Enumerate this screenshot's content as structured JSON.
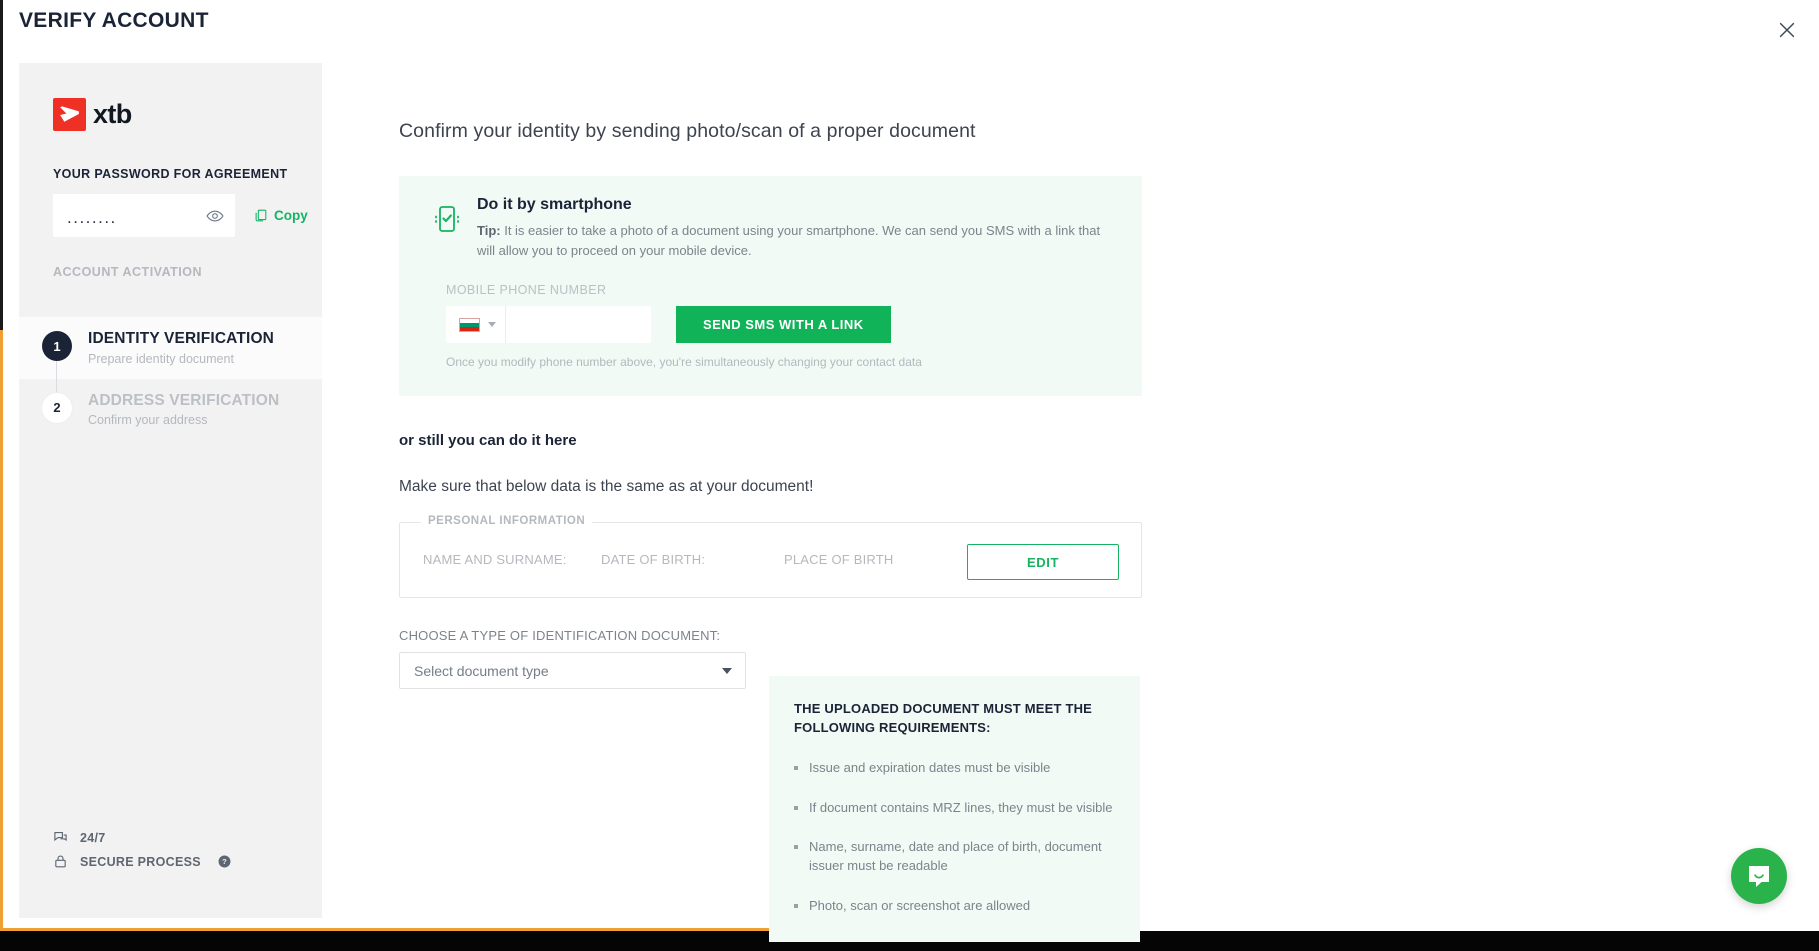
{
  "header": {
    "title": "VERIFY ACCOUNT",
    "close_icon": "close-icon"
  },
  "sidebar": {
    "brand": {
      "name": "xtb",
      "logo_icon": "xtb-logo-icon",
      "accent": "#ef3024"
    },
    "password": {
      "label": "YOUR PASSWORD FOR AGREEMENT",
      "value": "........",
      "toggle_icon": "eye-icon",
      "copy_label": "Copy",
      "copy_icon": "copy-icon",
      "copy_color": "#16b364"
    },
    "section_label": "ACCOUNT ACTIVATION",
    "steps": [
      {
        "number": "1",
        "title": "IDENTITY VERIFICATION",
        "subtitle": "Prepare identity document",
        "state": "active"
      },
      {
        "number": "2",
        "title": "ADDRESS VERIFICATION",
        "subtitle": "Confirm your address",
        "state": "inactive"
      }
    ],
    "footer": [
      {
        "icon": "chat-icon",
        "label": "24/7",
        "help": false
      },
      {
        "icon": "lock-icon",
        "label": "SECURE PROCESS",
        "help": true,
        "help_icon": "help-circle-icon"
      }
    ]
  },
  "main": {
    "heading": "Confirm your identity by sending photo/scan of a proper document",
    "sms_panel": {
      "icon": "smartphone-check-icon",
      "title": "Do it by smartphone",
      "tip_prefix": "Tip:",
      "tip_text": " It is easier to take a photo of a document using your smartphone. We can send you SMS with a link that will allow you to proceed on your mobile device.",
      "phone_label": "MOBILE PHONE NUMBER",
      "country_flag": "bulgaria-flag-icon",
      "phone_value": "",
      "phone_placeholder": "",
      "send_button": "SEND SMS WITH A LINK",
      "send_button_color": "#11b358",
      "note": "Once you modify phone number above, you're simultaneously changing your contact data",
      "panel_bg": "#f1faf4"
    },
    "still_here": "or still you can do it here",
    "make_sure": "Make sure that below data is the same as at your document!",
    "personal_information": {
      "legend": "PERSONAL INFORMATION",
      "fields": [
        {
          "label": "NAME AND SURNAME:",
          "value": ""
        },
        {
          "label": "DATE OF BIRTH:",
          "value": ""
        },
        {
          "label": "PLACE OF BIRTH",
          "value": ""
        }
      ],
      "edit_button": "EDIT",
      "edit_color": "#16b364"
    },
    "document": {
      "label": "CHOOSE A TYPE OF IDENTIFICATION DOCUMENT:",
      "selected": "Select document type",
      "caret_icon": "chevron-down-icon"
    },
    "requirements": {
      "title": "THE UPLOADED DOCUMENT MUST MEET THE FOLLOWING REQUIREMENTS:",
      "items": [
        "Issue and expiration dates must be visible",
        "If document contains MRZ lines, they must be visible",
        "Name, surname, date and place of birth, document issuer must be readable",
        "Photo, scan or screenshot are allowed"
      ]
    }
  },
  "intercom": {
    "icon": "chat-smile-icon",
    "color": "#2ab34a"
  }
}
